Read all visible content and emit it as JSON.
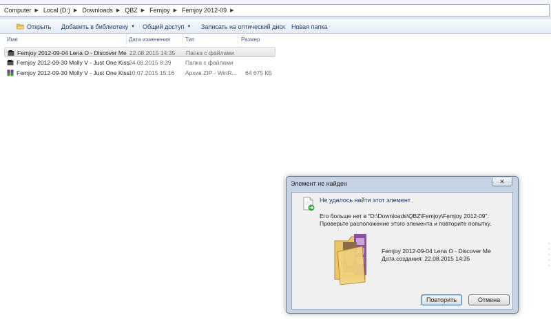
{
  "breadcrumb": [
    "Computer",
    "Local (D:)",
    "Downloads",
    "QBZ",
    "Femjoy",
    "Femjoy 2012-09"
  ],
  "toolbar": {
    "open_label": "Открыть",
    "library_label": "Добавить в библиотеку",
    "share_label": "Общий доступ",
    "burn_label": "Записать на оптический диск",
    "new_folder_label": "Новая папка"
  },
  "columns": {
    "name": "Имя",
    "date": "Дата изменения",
    "type": "Тип",
    "size": "Размер"
  },
  "files": [
    {
      "name": "Femjoy 2012-09-04 Lena O - Discover Me",
      "date": "22.08.2015 14:35",
      "type": "Папка с файлами",
      "size": "",
      "icon": "folder-icon",
      "selected": true
    },
    {
      "name": "Femjoy 2012-09-30 Molly V - Just One Kiss",
      "date": "24.08.2015 8:39",
      "type": "Папка с файлами",
      "size": "",
      "icon": "folder-icon",
      "selected": false
    },
    {
      "name": "Femjoy 2012-09-30 Molly V - Just One Kiss",
      "date": "10.07.2015 15:16",
      "type": "Архив ZIP - WinR...",
      "size": "64 675 КБ",
      "icon": "zip-archive-icon",
      "selected": false
    }
  ],
  "dialog": {
    "title": "Элемент не найден",
    "close_symbol": "✕",
    "main_message": "Не удалось найти этот элемент",
    "description": "Его больше нет в \"D:\\Downloads\\QBZ\\Femjoy\\Femjoy 2012-09\". Проверьте расположение этого элемента и повторите попытку.",
    "item_name": "Femjoy 2012-09-04 Lena O - Discover Me",
    "item_date": "Дата создания: 22.08.2015 14:35",
    "retry_label": "Повторить",
    "cancel_label": "Отмена"
  },
  "colors": {
    "accent_text": "#1f3d75",
    "dialog_frame": "#c5d3e4",
    "selected_row": "#e8e8e8"
  }
}
